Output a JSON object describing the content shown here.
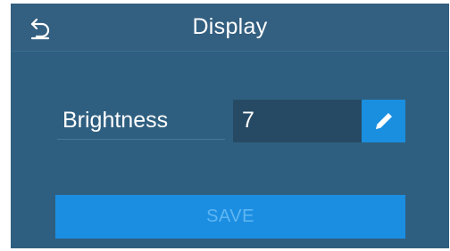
{
  "header": {
    "title": "Display",
    "back_icon": "back-arrow-icon"
  },
  "settings": {
    "brightness_label": "Brightness",
    "brightness_value": "7",
    "edit_icon": "pencil-icon"
  },
  "actions": {
    "save_label": "SAVE",
    "save_enabled": false
  },
  "colors": {
    "background": "#2f5f80",
    "field": "#264a63",
    "accent": "#1a8fe0",
    "save_text_disabled": "#5fb6f2"
  }
}
